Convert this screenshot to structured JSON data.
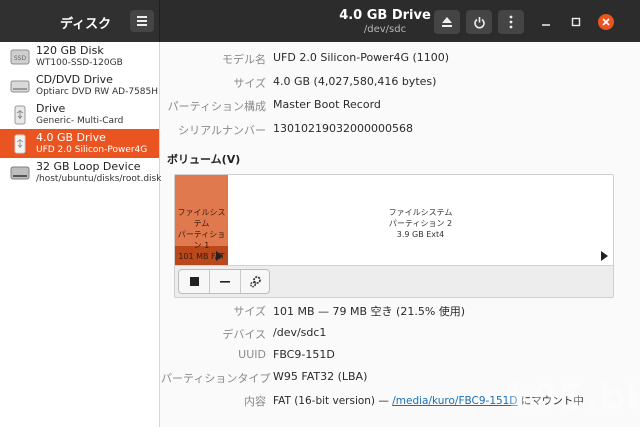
{
  "app": {
    "title": "ディスク",
    "window_title": "4.0 GB Drive",
    "window_subtitle": "/dev/sdc"
  },
  "sidebar": {
    "items": [
      {
        "name": "120 GB Disk",
        "sub": "WT100-SSD-120GB",
        "icon": "ssd-icon",
        "icon_text": "SSD",
        "selected": false
      },
      {
        "name": "CD/DVD Drive",
        "sub": "Optiarc DVD RW AD-7585H",
        "icon": "optical-drive-icon",
        "selected": false
      },
      {
        "name": "Drive",
        "sub": "Generic- Multi-Card",
        "icon": "usb-drive-icon",
        "selected": false
      },
      {
        "name": "4.0 GB Drive",
        "sub": "UFD 2.0 Silicon-Power4G",
        "icon": "usb-drive-icon",
        "selected": true
      },
      {
        "name": "32 GB Loop Device",
        "sub": "/host/ubuntu/disks/root.disk",
        "icon": "loop-device-icon",
        "selected": false
      }
    ]
  },
  "drive_props": {
    "model_label": "モデル名",
    "model_value": "UFD 2.0 Silicon-Power4G (1100)",
    "size_label": "サイズ",
    "size_value": "4.0 GB (4,027,580,416 bytes)",
    "partitioning_label": "パーティション構成",
    "partitioning_value": "Master Boot Record",
    "serial_label": "シリアルナンバー",
    "serial_value": "13010219032000000568"
  },
  "volumes": {
    "title": "ボリューム(V)",
    "partitions": [
      {
        "line1": "ファイルシステム",
        "line2": "パーティション 1",
        "line3": "101 MB FAT",
        "selected": true,
        "used_fraction": 0.215
      },
      {
        "line1": "ファイルシステム",
        "line2": "パーティション 2",
        "line3": "3.9 GB Ext4",
        "selected": false
      }
    ]
  },
  "partition_props": {
    "size_label": "サイズ",
    "size_value": "101 MB — 79 MB 空き (21.5% 使用)",
    "device_label": "デバイス",
    "device_value": "/dev/sdc1",
    "uuid_label": "UUID",
    "uuid_value": "FBC9-151D",
    "type_label": "パーティションタイプ",
    "type_value": "W95 FAT32 (LBA)",
    "content_label": "内容",
    "content_prefix": "FAT (16-bit version) — ",
    "content_link": "/media/kuro/FBC9-151D",
    "content_suffix": " にマウント中"
  },
  "watermark": "k05.biz",
  "colors": {
    "accent": "#e95420",
    "titlebar": "#2c2c2c",
    "close": "#e95420",
    "link": "#1a6fb5"
  }
}
